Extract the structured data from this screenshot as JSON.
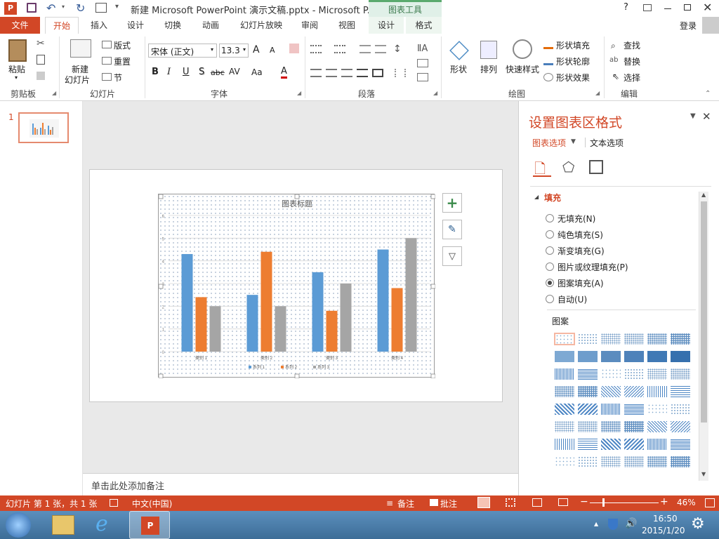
{
  "titlebar": {
    "title": "新建 Microsoft PowerPoint 演示文稿.pptx - Microsoft P...",
    "context_label": "图表工具",
    "help": "?"
  },
  "tabs": [
    {
      "label": "文件"
    },
    {
      "label": "开始"
    },
    {
      "label": "插入"
    },
    {
      "label": "设计"
    },
    {
      "label": "切换"
    },
    {
      "label": "动画"
    },
    {
      "label": "幻灯片放映"
    },
    {
      "label": "审阅"
    },
    {
      "label": "视图"
    },
    {
      "label": "设计"
    },
    {
      "label": "格式"
    }
  ],
  "signin": "登录",
  "ribbon": {
    "clipboard": {
      "paste": "粘贴",
      "group": "剪贴板"
    },
    "slides": {
      "new_slide": "新建",
      "new_slide2": "幻灯片",
      "layout": "版式",
      "reset": "重置",
      "section": "节",
      "group": "幻灯片"
    },
    "font": {
      "name": "宋体 (正文)",
      "size": "13.3",
      "group": "字体",
      "aa": "Aa"
    },
    "paragraph": {
      "group": "段落"
    },
    "drawing": {
      "shapes": "形状",
      "arrange": "排列",
      "quick_styles": "快速样式",
      "fill": "形状填充",
      "outline": "形状轮廓",
      "effects": "形状效果",
      "group": "绘图"
    },
    "editing": {
      "find": "查找",
      "replace": "替换",
      "select": "选择",
      "group": "编辑"
    }
  },
  "slide_thumb": {
    "number": "1"
  },
  "notes_placeholder": "单击此处添加备注",
  "chart_data": {
    "type": "bar",
    "title": "图表标题",
    "categories": [
      "类别 1",
      "类别 2",
      "类别 3",
      "类别 4"
    ],
    "series": [
      {
        "name": "系列 1",
        "values": [
          4.3,
          2.5,
          3.5,
          4.5
        ],
        "color": "#5b9bd5"
      },
      {
        "name": "系列 2",
        "values": [
          2.4,
          4.4,
          1.8,
          2.8
        ],
        "color": "#ed7d31"
      },
      {
        "name": "系列 3",
        "values": [
          2,
          2,
          3,
          5
        ],
        "color": "#a5a5a5"
      }
    ],
    "ylim": [
      0,
      6
    ],
    "yticks": [
      "0",
      "1",
      "2",
      "3",
      "4",
      "5",
      "6"
    ],
    "legend": "bottom",
    "grid": true
  },
  "task_pane": {
    "title": "设置图表区格式",
    "tab_chart": "图表选项",
    "tab_text": "文本选项",
    "section": "填充",
    "options": [
      {
        "label": "无填充(N)",
        "selected": false
      },
      {
        "label": "纯色填充(S)",
        "selected": false
      },
      {
        "label": "渐变填充(G)",
        "selected": false
      },
      {
        "label": "图片或纹理填充(P)",
        "selected": false
      },
      {
        "label": "图案填充(A)",
        "selected": true
      },
      {
        "label": "自动(U)",
        "selected": false
      }
    ],
    "pattern_label": "图案"
  },
  "status": {
    "slide_info": "幻灯片 第 1 张，共 1 张",
    "language": "中文(中国)",
    "notes": "备注",
    "comments": "批注",
    "zoom": "46%"
  },
  "taskbar": {
    "time": "16:50",
    "date": "2015/1/20"
  },
  "colors": {
    "accent": "#d24726",
    "series1": "#5b9bd5",
    "series2": "#ed7d31",
    "series3": "#a5a5a5"
  }
}
